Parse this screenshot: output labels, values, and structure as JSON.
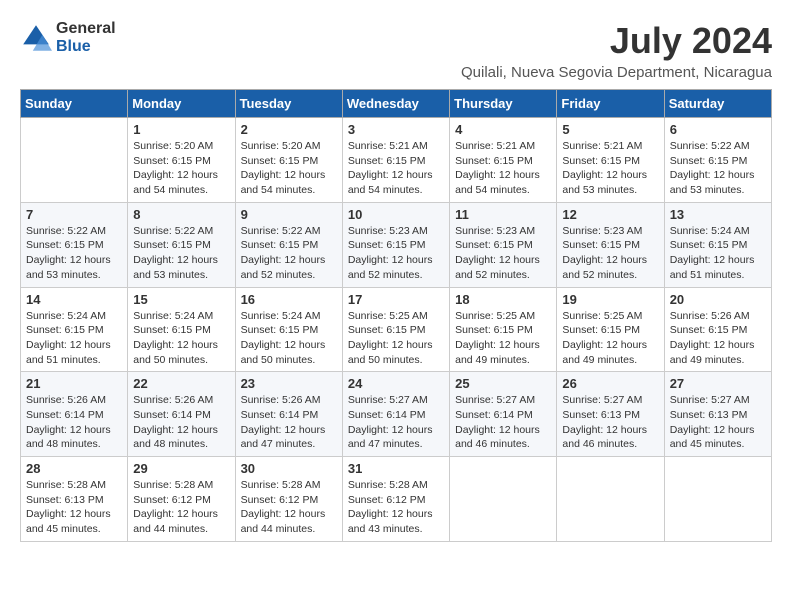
{
  "header": {
    "logo_general": "General",
    "logo_blue": "Blue",
    "month_title": "July 2024",
    "location": "Quilali, Nueva Segovia Department, Nicaragua"
  },
  "calendar": {
    "days_of_week": [
      "Sunday",
      "Monday",
      "Tuesday",
      "Wednesday",
      "Thursday",
      "Friday",
      "Saturday"
    ],
    "weeks": [
      [
        {
          "day": "",
          "info": ""
        },
        {
          "day": "1",
          "info": "Sunrise: 5:20 AM\nSunset: 6:15 PM\nDaylight: 12 hours\nand 54 minutes."
        },
        {
          "day": "2",
          "info": "Sunrise: 5:20 AM\nSunset: 6:15 PM\nDaylight: 12 hours\nand 54 minutes."
        },
        {
          "day": "3",
          "info": "Sunrise: 5:21 AM\nSunset: 6:15 PM\nDaylight: 12 hours\nand 54 minutes."
        },
        {
          "day": "4",
          "info": "Sunrise: 5:21 AM\nSunset: 6:15 PM\nDaylight: 12 hours\nand 54 minutes."
        },
        {
          "day": "5",
          "info": "Sunrise: 5:21 AM\nSunset: 6:15 PM\nDaylight: 12 hours\nand 53 minutes."
        },
        {
          "day": "6",
          "info": "Sunrise: 5:22 AM\nSunset: 6:15 PM\nDaylight: 12 hours\nand 53 minutes."
        }
      ],
      [
        {
          "day": "7",
          "info": "Sunrise: 5:22 AM\nSunset: 6:15 PM\nDaylight: 12 hours\nand 53 minutes."
        },
        {
          "day": "8",
          "info": "Sunrise: 5:22 AM\nSunset: 6:15 PM\nDaylight: 12 hours\nand 53 minutes."
        },
        {
          "day": "9",
          "info": "Sunrise: 5:22 AM\nSunset: 6:15 PM\nDaylight: 12 hours\nand 52 minutes."
        },
        {
          "day": "10",
          "info": "Sunrise: 5:23 AM\nSunset: 6:15 PM\nDaylight: 12 hours\nand 52 minutes."
        },
        {
          "day": "11",
          "info": "Sunrise: 5:23 AM\nSunset: 6:15 PM\nDaylight: 12 hours\nand 52 minutes."
        },
        {
          "day": "12",
          "info": "Sunrise: 5:23 AM\nSunset: 6:15 PM\nDaylight: 12 hours\nand 52 minutes."
        },
        {
          "day": "13",
          "info": "Sunrise: 5:24 AM\nSunset: 6:15 PM\nDaylight: 12 hours\nand 51 minutes."
        }
      ],
      [
        {
          "day": "14",
          "info": "Sunrise: 5:24 AM\nSunset: 6:15 PM\nDaylight: 12 hours\nand 51 minutes."
        },
        {
          "day": "15",
          "info": "Sunrise: 5:24 AM\nSunset: 6:15 PM\nDaylight: 12 hours\nand 50 minutes."
        },
        {
          "day": "16",
          "info": "Sunrise: 5:24 AM\nSunset: 6:15 PM\nDaylight: 12 hours\nand 50 minutes."
        },
        {
          "day": "17",
          "info": "Sunrise: 5:25 AM\nSunset: 6:15 PM\nDaylight: 12 hours\nand 50 minutes."
        },
        {
          "day": "18",
          "info": "Sunrise: 5:25 AM\nSunset: 6:15 PM\nDaylight: 12 hours\nand 49 minutes."
        },
        {
          "day": "19",
          "info": "Sunrise: 5:25 AM\nSunset: 6:15 PM\nDaylight: 12 hours\nand 49 minutes."
        },
        {
          "day": "20",
          "info": "Sunrise: 5:26 AM\nSunset: 6:15 PM\nDaylight: 12 hours\nand 49 minutes."
        }
      ],
      [
        {
          "day": "21",
          "info": "Sunrise: 5:26 AM\nSunset: 6:14 PM\nDaylight: 12 hours\nand 48 minutes."
        },
        {
          "day": "22",
          "info": "Sunrise: 5:26 AM\nSunset: 6:14 PM\nDaylight: 12 hours\nand 48 minutes."
        },
        {
          "day": "23",
          "info": "Sunrise: 5:26 AM\nSunset: 6:14 PM\nDaylight: 12 hours\nand 47 minutes."
        },
        {
          "day": "24",
          "info": "Sunrise: 5:27 AM\nSunset: 6:14 PM\nDaylight: 12 hours\nand 47 minutes."
        },
        {
          "day": "25",
          "info": "Sunrise: 5:27 AM\nSunset: 6:14 PM\nDaylight: 12 hours\nand 46 minutes."
        },
        {
          "day": "26",
          "info": "Sunrise: 5:27 AM\nSunset: 6:13 PM\nDaylight: 12 hours\nand 46 minutes."
        },
        {
          "day": "27",
          "info": "Sunrise: 5:27 AM\nSunset: 6:13 PM\nDaylight: 12 hours\nand 45 minutes."
        }
      ],
      [
        {
          "day": "28",
          "info": "Sunrise: 5:28 AM\nSunset: 6:13 PM\nDaylight: 12 hours\nand 45 minutes."
        },
        {
          "day": "29",
          "info": "Sunrise: 5:28 AM\nSunset: 6:12 PM\nDaylight: 12 hours\nand 44 minutes."
        },
        {
          "day": "30",
          "info": "Sunrise: 5:28 AM\nSunset: 6:12 PM\nDaylight: 12 hours\nand 44 minutes."
        },
        {
          "day": "31",
          "info": "Sunrise: 5:28 AM\nSunset: 6:12 PM\nDaylight: 12 hours\nand 43 minutes."
        },
        {
          "day": "",
          "info": ""
        },
        {
          "day": "",
          "info": ""
        },
        {
          "day": "",
          "info": ""
        }
      ]
    ]
  }
}
